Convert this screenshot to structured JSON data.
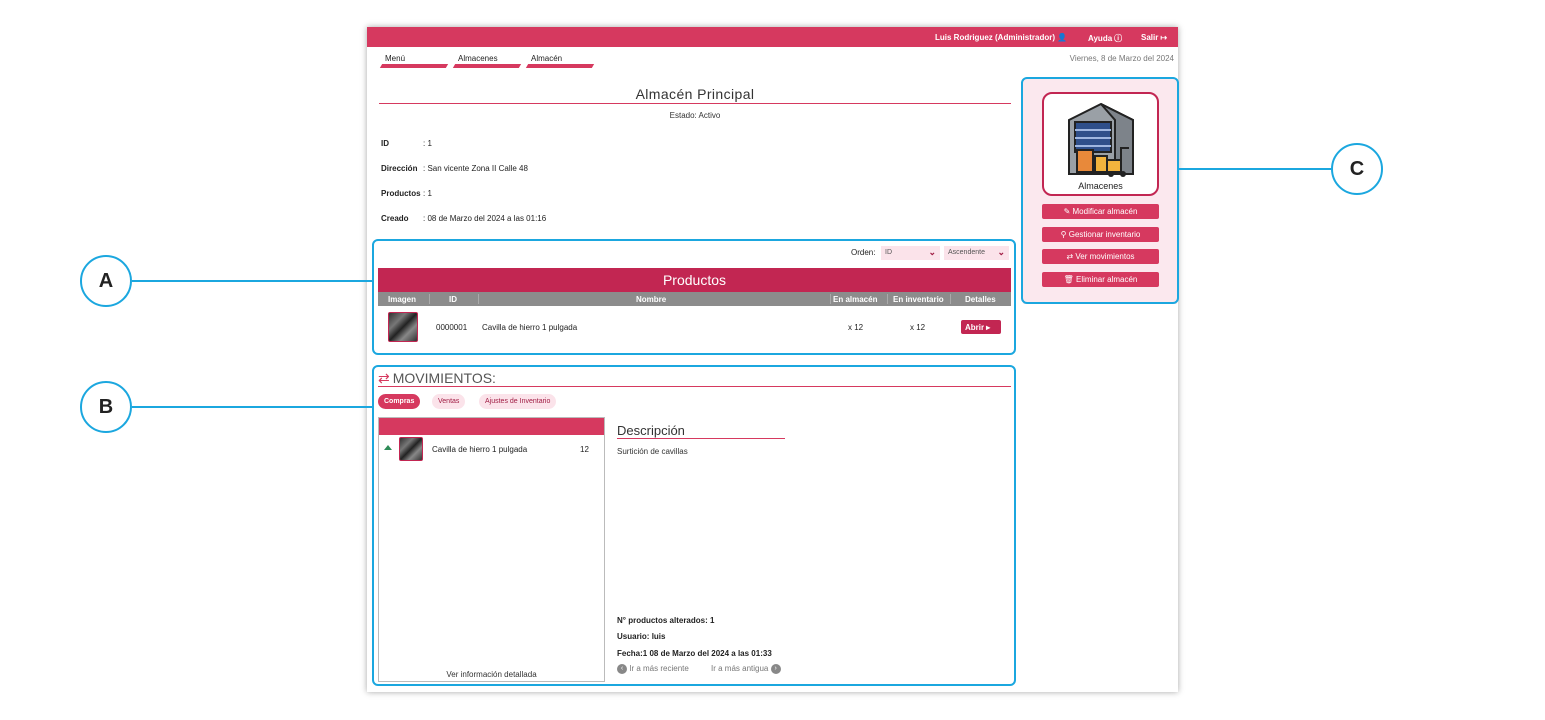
{
  "topbar": {
    "user": "Luis Rodriguez (Administrador)",
    "help": "Ayuda",
    "exit": "Salir"
  },
  "breadcrumb": [
    "Menú",
    "Almacenes",
    "Almacén"
  ],
  "date": "Viernes, 8 de Marzo del 2024",
  "warehouse": {
    "title": "Almacén Principal",
    "status": "Estado: Activo",
    "id_label": "ID",
    "id_value": ": 1",
    "address_label": "Dirección",
    "address_value": ": San vicente Zona II Calle 48",
    "products_label": "Productos",
    "products_value": ": 1",
    "created_label": "Creado",
    "created_value": ": 08 de Marzo del 2024 a las 01:16"
  },
  "order": {
    "label": "Orden:",
    "field": "ID",
    "direction": "Ascendente"
  },
  "products_table": {
    "title": "Productos",
    "columns": [
      "Imagen",
      "ID",
      "Nombre",
      "En almacén",
      "En inventario",
      "Detalles"
    ],
    "rows": [
      {
        "id": "0000001",
        "name": "Cavilla de hierro 1 pulgada",
        "in_warehouse": "x 12",
        "in_inventory": "x 12",
        "action": "Abrir"
      }
    ]
  },
  "movements": {
    "title": "MOVIMIENTOS:",
    "tabs": [
      "Compras",
      "Ventas",
      "Ajustes de Inventario"
    ],
    "active_tab": "Compras",
    "items": [
      {
        "name": "Cavilla de hierro 1 pulgada",
        "qty": "12"
      }
    ],
    "details_link": "Ver información detallada",
    "description_title": "Descripción",
    "description_text": "Surtición de cavillas",
    "altered_label": "N° productos alterados:",
    "altered_value": "1",
    "user_label": "Usuario:",
    "user_value": "luis",
    "date_label": "Fecha:",
    "date_value": "1 08 de Marzo del 2024 a las 01:33",
    "nav_recent": "Ir a más reciente",
    "nav_old": "Ir a más antigua"
  },
  "sidebar": {
    "card_label": "Almacenes",
    "buttons": [
      "Modificar almacén",
      "Gestionar inventario",
      "Ver movimientos",
      "Eliminar almacén"
    ]
  },
  "annotations": [
    "A",
    "B",
    "C"
  ],
  "colors": {
    "brand": "#d6395f",
    "brand_dark": "#c22652",
    "annotation": "#1ba7df"
  }
}
